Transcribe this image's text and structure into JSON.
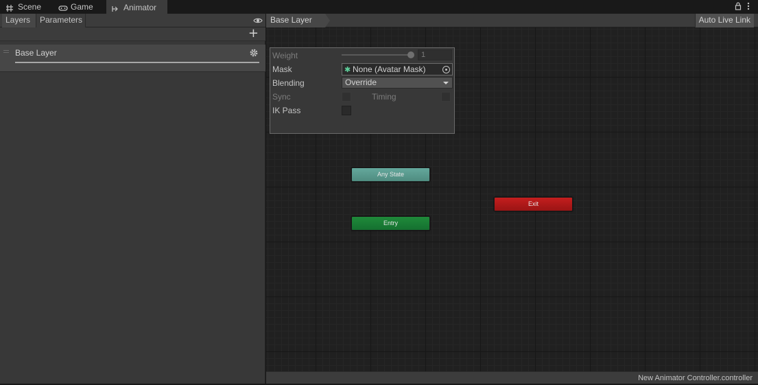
{
  "window_tabs": [
    {
      "label": "Scene",
      "icon": "grid-icon"
    },
    {
      "label": "Game",
      "icon": "gamepad-icon"
    },
    {
      "label": "Animator",
      "icon": "animator-icon",
      "active": true
    }
  ],
  "left_panel": {
    "tabs": [
      "Layers",
      "Parameters"
    ],
    "layers": [
      {
        "name": "Base Layer"
      }
    ]
  },
  "graph": {
    "breadcrumb": "Base Layer",
    "auto_live_link": "Auto Live Link",
    "states": {
      "any_state": "Any State",
      "entry": "Entry",
      "exit": "Exit"
    },
    "state_colors": {
      "any_state": "#5a9a8e",
      "entry": "#1a7f36",
      "exit": "#b31a1a"
    }
  },
  "layer_settings": {
    "weight_label": "Weight",
    "weight_value": "1",
    "weight_fraction": 1.0,
    "mask_label": "Mask",
    "mask_value": "None (Avatar Mask)",
    "blending_label": "Blending",
    "blending_value": "Override",
    "sync_label": "Sync",
    "sync_checked": false,
    "timing_label": "Timing",
    "timing_checked": false,
    "ik_pass_label": "IK Pass",
    "ik_pass_checked": false
  },
  "status_bar": {
    "file": "New Animator Controller.controller"
  }
}
